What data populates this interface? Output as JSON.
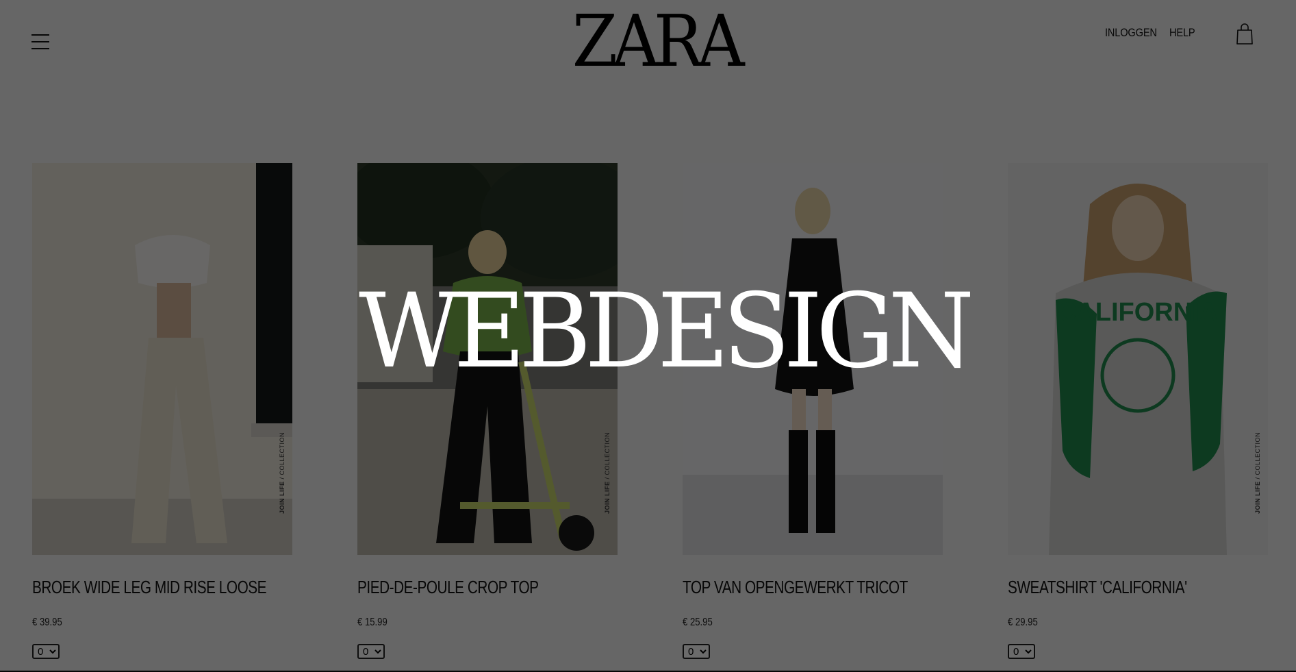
{
  "header": {
    "logo": "ZARA",
    "nav": {
      "login": "INLOGGEN",
      "help": "HELP"
    }
  },
  "products": [
    {
      "name": "BROEK WIDE LEG MID RISE LOOSE",
      "price": "€ 39.95",
      "qty": "0",
      "tag_bold": "JOIN LIFE",
      "tag_rest": " / COLLECTION"
    },
    {
      "name": "PIED-DE-POULE CROP TOP",
      "price": "€ 15.99",
      "qty": "0",
      "tag_bold": "JOIN LIFE",
      "tag_rest": " / COLLECTION"
    },
    {
      "name": "TOP VAN OPENGEWERKT TRICOT",
      "price": "€ 25.95",
      "qty": "0"
    },
    {
      "name": "SWEATSHIRT 'CALIFORNIA'",
      "price": "€ 29.95",
      "qty": "0",
      "tag_bold": "JOIN LIFE",
      "tag_rest": " / COLLECTION"
    }
  ],
  "overlay": {
    "title": "WEBDESIGN"
  },
  "colors": {
    "page_bg": "#f2f2f2",
    "overlay": "rgba(0,0,0,0.58)",
    "overlay_text": "#ffffff",
    "sweater_green": "#1f8a4c"
  }
}
